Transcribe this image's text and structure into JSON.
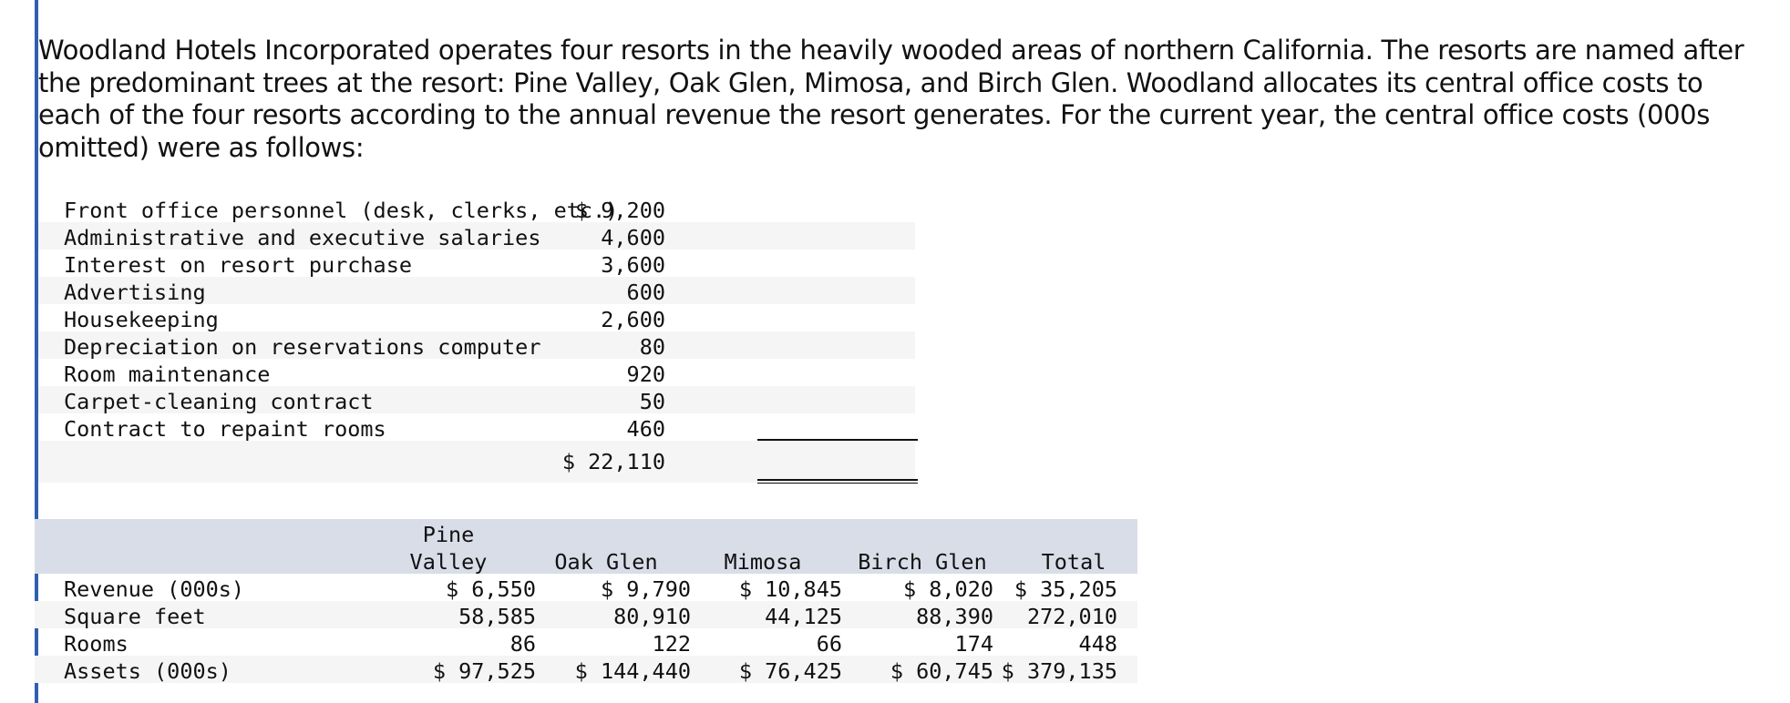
{
  "intro": "Woodland Hotels Incorporated operates four resorts in the heavily wooded areas of northern California. The resorts are named after the predominant trees at the resort: Pine Valley, Oak Glen, Mimosa, and Birch Glen. Woodland allocates its central office costs to each of the four resorts according to the annual revenue the resort generates. For the current year, the central office costs (000s omitted) were as follows:",
  "costs": {
    "rows": [
      {
        "label": "Front office personnel (desk, clerks, etc.)",
        "amount": "$ 9,200"
      },
      {
        "label": "Administrative and executive salaries",
        "amount": "4,600"
      },
      {
        "label": "Interest on resort purchase",
        "amount": "3,600"
      },
      {
        "label": "Advertising",
        "amount": "600"
      },
      {
        "label": "Housekeeping",
        "amount": "2,600"
      },
      {
        "label": "Depreciation on reservations computer",
        "amount": "80"
      },
      {
        "label": "Room maintenance",
        "amount": "920"
      },
      {
        "label": "Carpet-cleaning contract",
        "amount": "50"
      },
      {
        "label": "Contract to repaint rooms",
        "amount": "460"
      }
    ],
    "total": "$ 22,110"
  },
  "resorts": {
    "headers": {
      "pine_line1": "Pine",
      "pine_line2": "Valley",
      "oak": "Oak Glen",
      "mimosa": "Mimosa",
      "birch": "Birch Glen",
      "total": "Total"
    },
    "rows": [
      {
        "label": "Revenue (000s)",
        "values": [
          "$ 6,550",
          "$ 9,790",
          "$ 10,845",
          "$ 8,020",
          "$ 35,205"
        ]
      },
      {
        "label": "Square feet",
        "values": [
          "58,585",
          "80,910",
          "44,125",
          "88,390",
          "272,010"
        ]
      },
      {
        "label": "Rooms",
        "values": [
          "86",
          "122",
          "66",
          "174",
          "448"
        ]
      },
      {
        "label": "Assets (000s)",
        "values": [
          "$ 97,525",
          "$ 144,440",
          "$ 76,425",
          "$ 60,745",
          "$ 379,135"
        ]
      }
    ]
  }
}
